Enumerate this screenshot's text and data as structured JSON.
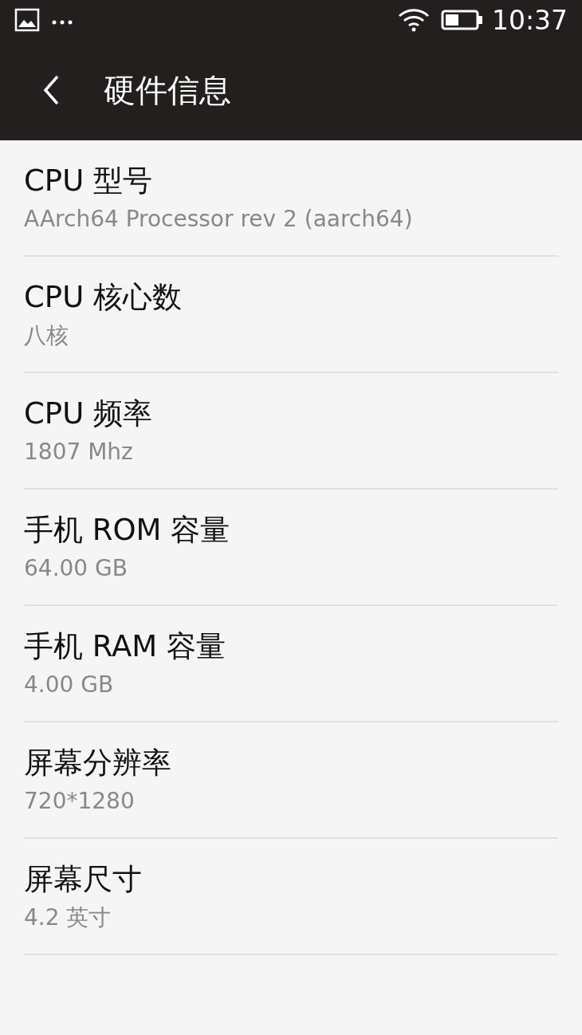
{
  "status_bar": {
    "time": "10:37"
  },
  "header": {
    "title": "硬件信息"
  },
  "items": [
    {
      "title": "CPU 型号",
      "value": "AArch64 Processor rev 2 (aarch64)"
    },
    {
      "title": "CPU 核心数",
      "value": "八核"
    },
    {
      "title": "CPU 频率",
      "value": "1807 Mhz"
    },
    {
      "title": "手机 ROM 容量",
      "value": "64.00 GB"
    },
    {
      "title": "手机 RAM 容量",
      "value": "4.00 GB"
    },
    {
      "title": "屏幕分辨率",
      "value": "720*1280"
    },
    {
      "title": "屏幕尺寸",
      "value": "4.2 英寸"
    }
  ]
}
